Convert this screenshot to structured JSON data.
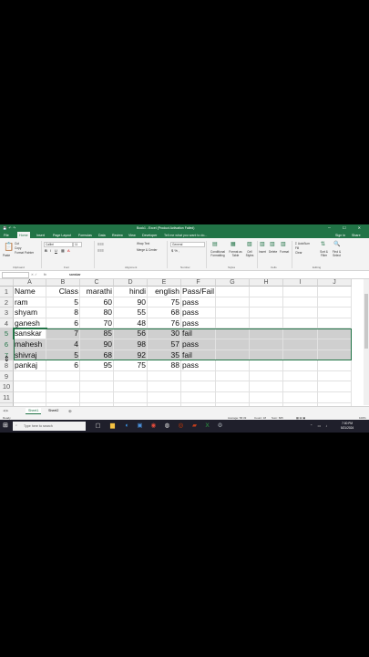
{
  "window": {
    "title": "Book1 - Excel (Product Activation Failed)",
    "signin": "Sign in",
    "share": "Share",
    "tell_me": "Tell me what you want to do..."
  },
  "tabs": [
    "File",
    "Home",
    "Insert",
    "Page Layout",
    "Formulas",
    "Data",
    "Review",
    "View",
    "Developer"
  ],
  "active_tab": "Home",
  "ribbon": {
    "clipboard": {
      "paste": "Paste",
      "cut": "Cut",
      "copy": "Copy",
      "format_painter": "Format Painter",
      "group": "Clipboard"
    },
    "font": {
      "name": "Calibri",
      "size": "11",
      "group": "Font"
    },
    "alignment": {
      "wrap": "Wrap Text",
      "merge": "Merge & Center",
      "group": "Alignment"
    },
    "number": {
      "format": "General",
      "group": "Number"
    },
    "styles": {
      "conditional": "Conditional Formatting",
      "format_table": "Format as Table",
      "cell_styles": "Cell Styles",
      "group": "Styles"
    },
    "cells": {
      "insert": "Insert",
      "delete": "Delete",
      "format": "Format",
      "group": "Cells"
    },
    "editing": {
      "autosum": "AutoSum",
      "fill": "Fill",
      "clear": "Clear",
      "sort": "Sort & Filter",
      "find": "Find & Select",
      "group": "Editing"
    }
  },
  "formula_bar": {
    "name_box": "",
    "fx": "fx",
    "value": "sanskar"
  },
  "columns": [
    "A",
    "B",
    "C",
    "D",
    "E",
    "F",
    "G",
    "H",
    "I",
    "J"
  ],
  "rows": [
    [
      "Name",
      "Class",
      "marathi",
      "hindi",
      "english",
      "Pass/Fail"
    ],
    [
      "ram",
      "5",
      "60",
      "90",
      "75",
      "pass"
    ],
    [
      "shyam",
      "8",
      "80",
      "55",
      "68",
      "pass"
    ],
    [
      "ganesh",
      "6",
      "70",
      "48",
      "76",
      "pass"
    ],
    [
      "sanskar",
      "7",
      "85",
      "56",
      "30",
      "fail"
    ],
    [
      "mahesh",
      "4",
      "90",
      "98",
      "57",
      "pass"
    ],
    [
      "shivraj",
      "5",
      "68",
      "92",
      "35",
      "fail"
    ],
    [
      "pankaj",
      "6",
      "95",
      "75",
      "88",
      "pass"
    ],
    [
      "",
      "",
      "",
      "",
      "",
      ""
    ],
    [
      "",
      "",
      "",
      "",
      "",
      ""
    ],
    [
      "",
      "",
      "",
      "",
      "",
      ""
    ],
    [
      "",
      "",
      "",
      "",
      "",
      ""
    ]
  ],
  "row_numbers": [
    "1",
    "2",
    "3",
    "4",
    "5",
    "6",
    "7",
    "8",
    "9",
    "10",
    "11",
    "12"
  ],
  "selected_rows": [
    5,
    6,
    7
  ],
  "sheets": [
    "Sheet1",
    "Sheet2"
  ],
  "status": {
    "ready": "Ready",
    "average": "Average: 58.33",
    "count": "Count: 18",
    "sum": "Sum: 825",
    "zoom": "100%"
  },
  "taskbar": {
    "search_placeholder": "Type here to search",
    "time": "7:00 PM",
    "date": "5/21/2024"
  },
  "colors": {
    "excel_green": "#217346",
    "selection": "#cfcfcf"
  }
}
